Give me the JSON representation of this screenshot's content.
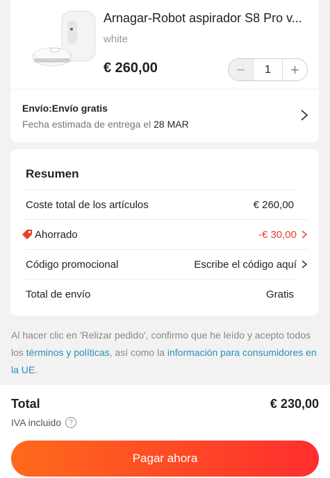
{
  "product": {
    "title": "Arnagar-Robot aspirador S8 Pro v...",
    "variant": "white",
    "price": "€ 260,00",
    "quantity": "1",
    "image_icon": "robot-vacuum-station-image"
  },
  "shipping": {
    "title": "Envío:Envío gratis",
    "date_prefix": "Fecha estimada de entrega el",
    "date": "28 MAR"
  },
  "summary": {
    "title": "Resumen",
    "rows": [
      {
        "label": "Coste total de los artículos",
        "value": "€ 260,00"
      },
      {
        "label": "Ahorrado",
        "value": "-€ 30,00"
      },
      {
        "label": "Código promocional",
        "value": "Escribe el código aquí"
      },
      {
        "label": "Total de envío",
        "value": "Gratis"
      }
    ]
  },
  "legal": {
    "text_1": "Al hacer clic en 'Relizar pedido', confirmo que he leído y acepto todos los",
    "link_1": "términos y políticas",
    "text_2": ", así como la",
    "link_2": "información para consumidores en la UE",
    "text_3": "."
  },
  "footer": {
    "total_label": "Total",
    "total_value": "€ 230,00",
    "iva_label": "IVA incluido",
    "pay_label": "Pagar ahora"
  },
  "colors": {
    "accent": "#ff2e2e",
    "saved": "#e8402f",
    "link": "#2a8fb7"
  }
}
